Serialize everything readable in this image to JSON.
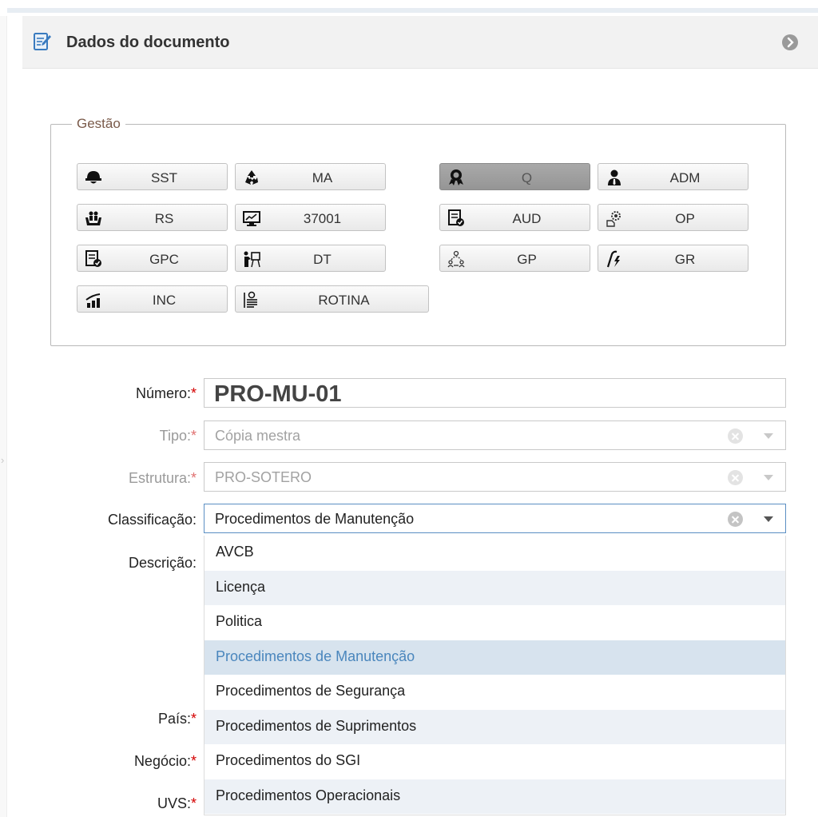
{
  "panel": {
    "title": "Dados do documento"
  },
  "gestao": {
    "legend": "Gestão",
    "buttons": [
      {
        "label": "SST",
        "icon": "hardhat-icon",
        "active": false
      },
      {
        "label": "MA",
        "icon": "recycle-icon",
        "active": false
      },
      {
        "label": "Q",
        "icon": "award-ribbon-icon",
        "active": true
      },
      {
        "label": "ADM",
        "icon": "user-tie-icon",
        "active": false
      },
      {
        "label": "RS",
        "icon": "hands-people-icon",
        "active": false
      },
      {
        "label": "37001",
        "icon": "monitor-chart-icon",
        "active": false
      },
      {
        "label": "AUD",
        "icon": "document-check-icon",
        "active": false
      },
      {
        "label": "OP",
        "icon": "gear-hand-icon",
        "active": false
      },
      {
        "label": "GPC",
        "icon": "document-check-icon",
        "active": false
      },
      {
        "label": "DT",
        "icon": "presentation-icon",
        "active": false
      },
      {
        "label": "GP",
        "icon": "team-network-icon",
        "active": false
      },
      {
        "label": "GR",
        "icon": "lightning-curve-icon",
        "active": false
      },
      {
        "label": "INC",
        "icon": "signal-bars-icon",
        "active": false
      },
      {
        "label": "ROTINA",
        "icon": "checklist-icon",
        "active": false
      }
    ]
  },
  "form": {
    "numero": {
      "label": "Número:",
      "required": "*",
      "value": "PRO-MU-01"
    },
    "tipo": {
      "label": "Tipo:",
      "required": "*",
      "value": "Cópia mestra"
    },
    "estrutura": {
      "label": "Estrutura:",
      "required": "*",
      "value": "PRO-SOTERO"
    },
    "classificacao": {
      "label": "Classificação:",
      "value": "Procedimentos de Manutenção"
    },
    "descricao": {
      "label": "Descrição:"
    },
    "pais": {
      "label": "País:",
      "required": "*"
    },
    "negocio": {
      "label": "Negócio:",
      "required": "*"
    },
    "uvs": {
      "label": "UVS:",
      "required": "*"
    }
  },
  "dropdown": {
    "options": [
      "AVCB",
      "Licença",
      "Politica",
      "Procedimentos de Manutenção",
      "Procedimentos de Segurança",
      "Procedimentos de Suprimentos",
      "Procedimentos do SGI",
      "Procedimentos Operacionais"
    ],
    "selected": "Procedimentos de Manutenção"
  },
  "colors": {
    "accent": "#4a86bd",
    "required": "#d40000",
    "selected_bg": "#d7e3ee"
  }
}
